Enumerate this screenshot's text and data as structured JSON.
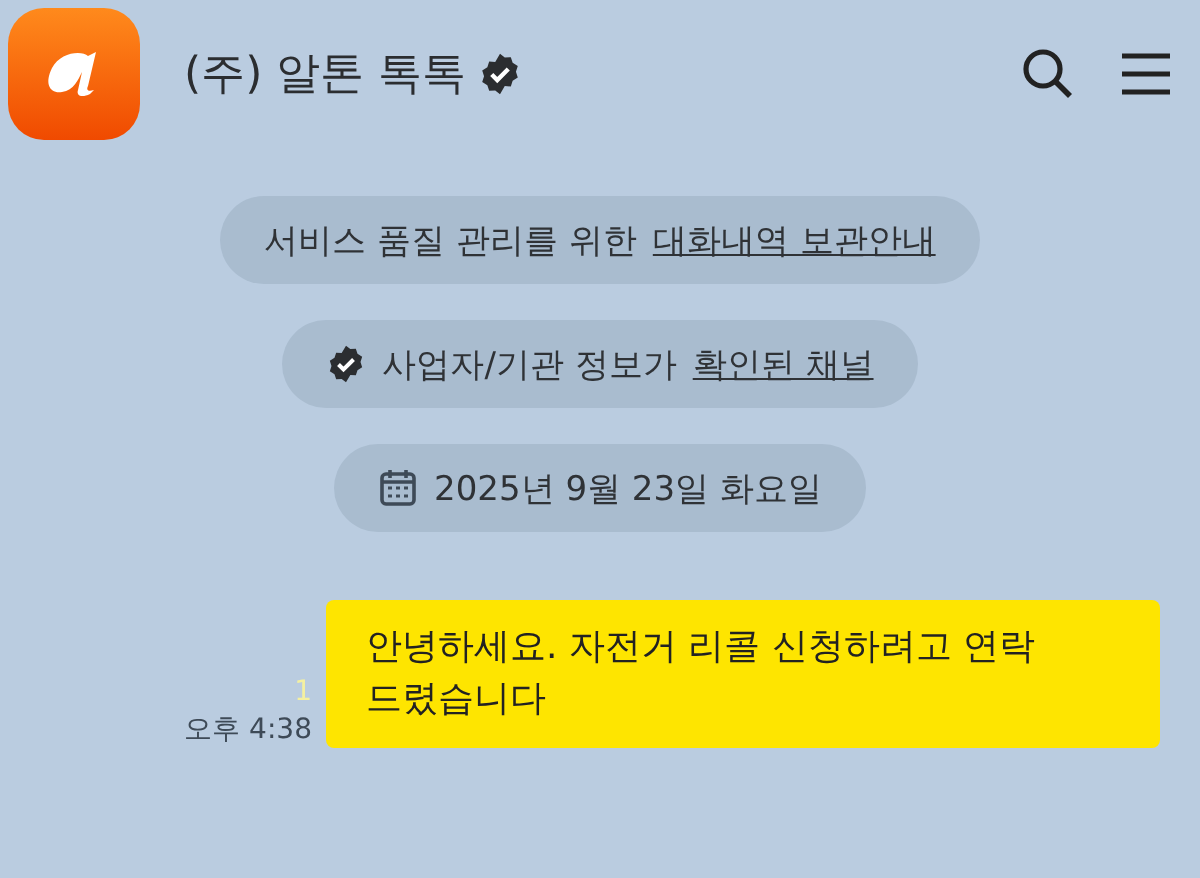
{
  "header": {
    "title": "(주) 알톤 톡톡",
    "verified": true
  },
  "notices": [
    {
      "kind": "info",
      "text": "서비스 품질 관리를 위한",
      "link": "대화내역 보관안내"
    },
    {
      "kind": "verified",
      "text": "사업자/기관 정보가",
      "link": "확인된 채널"
    },
    {
      "kind": "date",
      "text": "2025년 9월 23일 화요일"
    }
  ],
  "messages": [
    {
      "text": "안녕하세요.  자전거 리콜 신청하려고 연락 드렸습니다",
      "unread": "1",
      "time": "오후 4:38"
    }
  ]
}
